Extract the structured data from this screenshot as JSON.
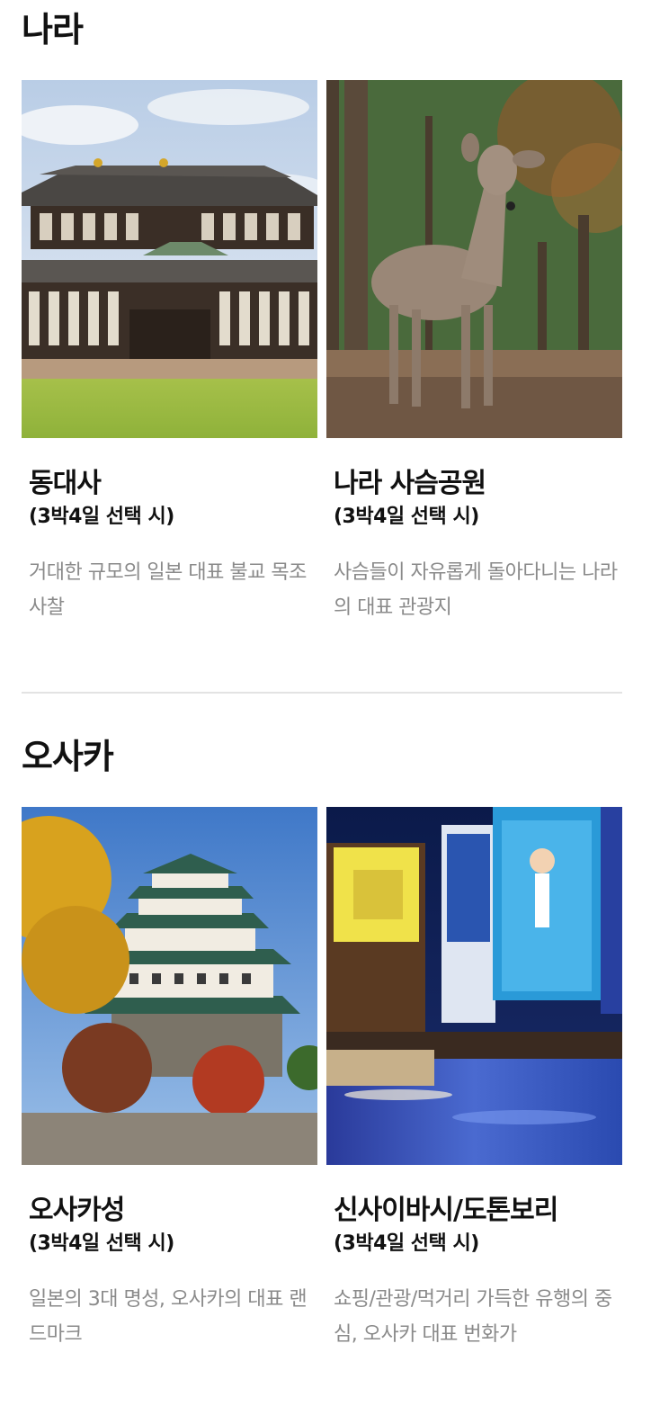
{
  "sections": [
    {
      "title": "나라",
      "cards": [
        {
          "title": "동대사",
          "subtitle": "(3박4일 선택 시)",
          "description": "거대한 규모의 일본 대표 불교 목조 사찰",
          "image": "todaiji-temple-photo"
        },
        {
          "title": "나라 사슴공원",
          "subtitle": "(3박4일 선택 시)",
          "description": "사슴들이 자유롭게 돌아다니는 나라의 대표 관광지",
          "image": "nara-deer-park-photo"
        }
      ]
    },
    {
      "title": "오사카",
      "cards": [
        {
          "title": "오사카성",
          "subtitle": "(3박4일 선택 시)",
          "description": "일본의 3대 명성, 오사카의 대표 랜드마크",
          "image": "osaka-castle-photo"
        },
        {
          "title": "신사이바시/도톤보리",
          "subtitle": "(3박4일 선택 시)",
          "description": "쇼핑/관광/먹거리 가득한 유행의 중심, 오사카 대표 번화가",
          "image": "dotonbori-photo"
        }
      ]
    }
  ],
  "colors": {
    "title": "#111111",
    "description": "#8a8a8a",
    "divider": "#e3e3e3"
  }
}
